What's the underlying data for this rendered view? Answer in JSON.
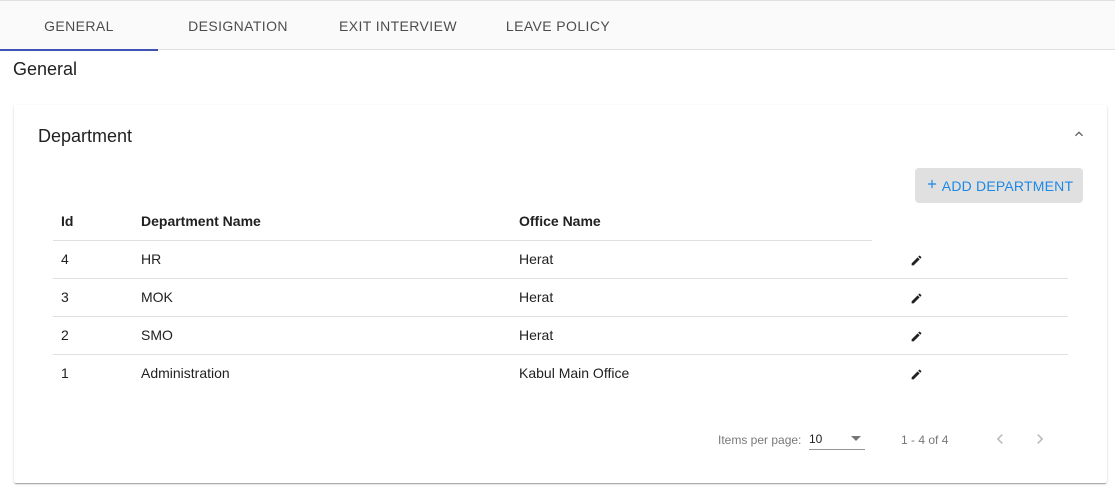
{
  "tabs": [
    {
      "label": "GENERAL",
      "active": true
    },
    {
      "label": "DESIGNATION",
      "active": false
    },
    {
      "label": "EXIT INTERVIEW",
      "active": false
    },
    {
      "label": "LEAVE POLICY",
      "active": false
    }
  ],
  "section_title": "General",
  "card": {
    "title": "Department",
    "collapse_icon": "chevron-up-icon",
    "add_button": {
      "icon": "plus-icon",
      "label": "ADD DEPARTMENT"
    }
  },
  "table": {
    "columns": [
      "Id",
      "Department Name",
      "Office Name",
      ""
    ],
    "rows": [
      {
        "id": "4",
        "department": "HR",
        "office": "Herat",
        "action_icon": "pencil-icon"
      },
      {
        "id": "3",
        "department": "MOK",
        "office": "Herat",
        "action_icon": "pencil-icon"
      },
      {
        "id": "2",
        "department": "SMO",
        "office": "Herat",
        "action_icon": "pencil-icon"
      },
      {
        "id": "1",
        "department": "Administration",
        "office": "Kabul Main Office",
        "action_icon": "pencil-icon"
      }
    ]
  },
  "paginator": {
    "items_per_page_label": "Items per page:",
    "page_size": "10",
    "range_label": "1 - 4 of 4",
    "prev_icon": "chevron-left-icon",
    "next_icon": "chevron-right-icon"
  },
  "colors": {
    "accent": "#3f51b5",
    "button_text": "#1e88e5",
    "button_bg": "#e0e0e0"
  }
}
